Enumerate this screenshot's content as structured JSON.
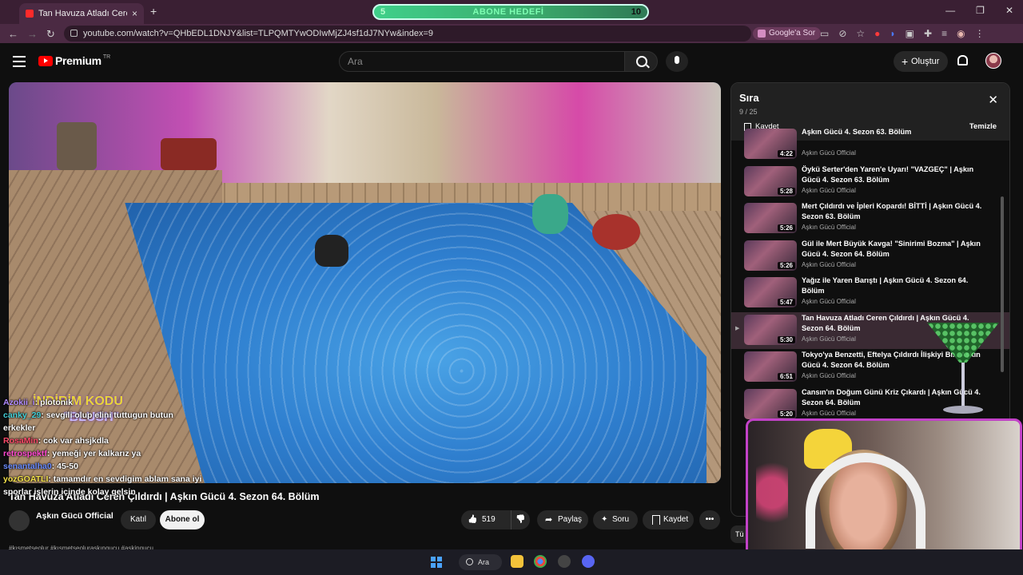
{
  "browser": {
    "tab_title": "Tan Havuza Atladı Ceren Çıldırdı | Aşkın Gücü 4. Sezon 64. Bölüm",
    "tab_close": "×",
    "new_tab": "+",
    "url": "youtube.com/watch?v=QHbEDL1DNJY&list=TLPQMTYwODIwMjZJ4sf1dJ7NYw&index=9",
    "google_sor": "Google'a Sor",
    "back": "←",
    "forward": "→",
    "reload": "↻",
    "min": "—",
    "max": "❐",
    "close": "✕"
  },
  "stream_goal": {
    "start": "5",
    "label": "ABONE HEDEFİ",
    "end": "10",
    "progress": 0.0
  },
  "header": {
    "logo_text": "Premium",
    "country": "TR",
    "search_placeholder": "Ara",
    "create_label": "Oluştur"
  },
  "video": {
    "title": "Tan Havuza Atladı Ceren Çıldırdı | Aşkın Gücü 4. Sezon 64. Bölüm",
    "channel": "Aşkın Gücü Official",
    "join": "Katıl",
    "subscribe": "Abone ol",
    "likes": "519",
    "share": "Paylaş",
    "ask": "Soru",
    "save": "Kaydet",
    "more": "•••",
    "tags": "#kısmetseolur #kısmetseoluraskıngucu #askingucu",
    "promo_line1": "İNDİRİM KODU",
    "promo_line2": "\"BLUSH\""
  },
  "chat": [
    {
      "user": "Azokii_i",
      "msg": ": plotonik"
    },
    {
      "user": "canky_29",
      "msg": ": sevgili olup elini tuttugun butun"
    },
    {
      "user": "",
      "msg": "erkekler"
    },
    {
      "user": "RosaMin",
      "msg": ": cok var ahsjkdla"
    },
    {
      "user": "retrospektf",
      "msg": ": yemeği yer kalkarız ya"
    },
    {
      "user": "senantalha0",
      "msg": ": 45-50"
    },
    {
      "user": "yozGOATLI",
      "msg": ": tamamdır en sevdigim ablam sana iyi"
    },
    {
      "user": "",
      "msg": "sporlar işlerin içinde kolay gelsin"
    }
  ],
  "playlist": {
    "title": "Sıra",
    "count": "9 / 25",
    "save": "Kaydet",
    "clear": "Temizle",
    "items": [
      {
        "title": "Aşkın Gücü 4. Sezon 63. Bölüm",
        "channel": "Aşkın Gücü Official",
        "duration": "4:22",
        "active": false
      },
      {
        "title": "Öykü Serter'den Yaren'e Uyarı! \"VAZGEÇ\" | Aşkın Gücü 4. Sezon 63. Bölüm",
        "channel": "Aşkın Gücü Official",
        "duration": "5:28",
        "active": false
      },
      {
        "title": "Mert Çıldırdı ve İpleri Kopardı! BİTTİ | Aşkın Gücü 4. Sezon 63. Bölüm",
        "channel": "Aşkın Gücü Official",
        "duration": "5:26",
        "active": false
      },
      {
        "title": "Gül ile Mert Büyük Kavga! \"Sinirimi Bozma\" | Aşkın Gücü 4. Sezon 64. Bölüm",
        "channel": "Aşkın Gücü Official",
        "duration": "5:26",
        "active": false
      },
      {
        "title": "Yağız ile Yaren Barıştı | Aşkın Gücü 4. Sezon 64. Bölüm",
        "channel": "Aşkın Gücü Official",
        "duration": "5:47",
        "active": false
      },
      {
        "title": "Tan Havuza Atladı Ceren Çıldırdı | Aşkın Gücü 4. Sezon 64. Bölüm",
        "channel": "Aşkın Gücü Official",
        "duration": "5:30",
        "active": true
      },
      {
        "title": "Tokyo'ya Benzetti, Eftelya Çıldırdı İlişkiyi Bi... Aşkın Gücü 4. Sezon 64. Bölüm",
        "channel": "Aşkın Gücü Official",
        "duration": "6:51",
        "active": false
      },
      {
        "title": "Cansın'ın Doğum Günü Kriz Çıkardı | Aşkın Gücü 4. Sezon 64. Bölüm",
        "channel": "Aşkın Gücü Official",
        "duration": "5:20",
        "active": false
      }
    ]
  },
  "partial_button": "Tü",
  "taskbar": {
    "search": "Ara"
  },
  "colors": {
    "accent_red": "#ff0000",
    "bg": "#0f0f0f",
    "chrome": "#3a1f33"
  }
}
